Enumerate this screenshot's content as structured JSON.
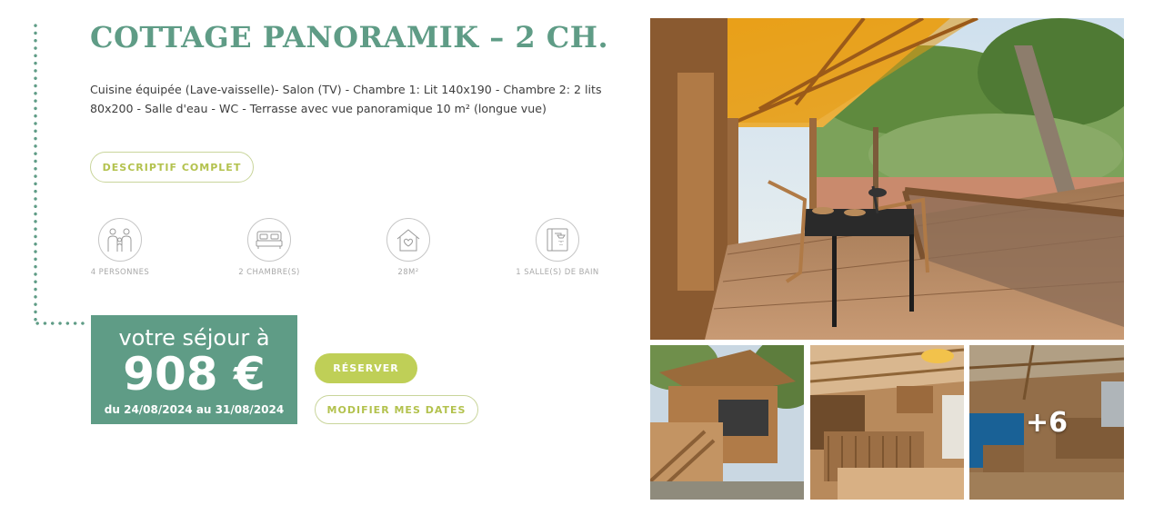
{
  "cottage": {
    "title": "COTTAGE PANORAMIK – 2 CH.",
    "description": "Cuisine équipée (Lave-vaisselle)- Salon (TV) - Chambre 1: Lit 140x190 - Chambre 2: 2 lits 80x200 - Salle d'eau - WC - Terrasse avec vue panoramique 10 m² (longue vue)",
    "full_description_button": "DESCRIPTIF COMPLET"
  },
  "features": [
    {
      "icon": "family-icon",
      "label": "4 PERSONNES"
    },
    {
      "icon": "bed-icon",
      "label": "2 CHAMBRE(S)"
    },
    {
      "icon": "house-heart-icon",
      "label": "28M²"
    },
    {
      "icon": "shower-icon",
      "label": "1 SALLE(S) DE BAIN"
    }
  ],
  "booking": {
    "stay_label": "votre séjour à",
    "price": "908 €",
    "dates": "du 24/08/2024 au 31/08/2024",
    "book_button": "RÉSERVER",
    "change_dates_button": "MODIFIER MES DATES"
  },
  "gallery": {
    "more_count": "+6"
  },
  "colors": {
    "accent_green": "#5f9c86",
    "lime": "#bfcf57",
    "lime_border": "#c9d59b"
  }
}
